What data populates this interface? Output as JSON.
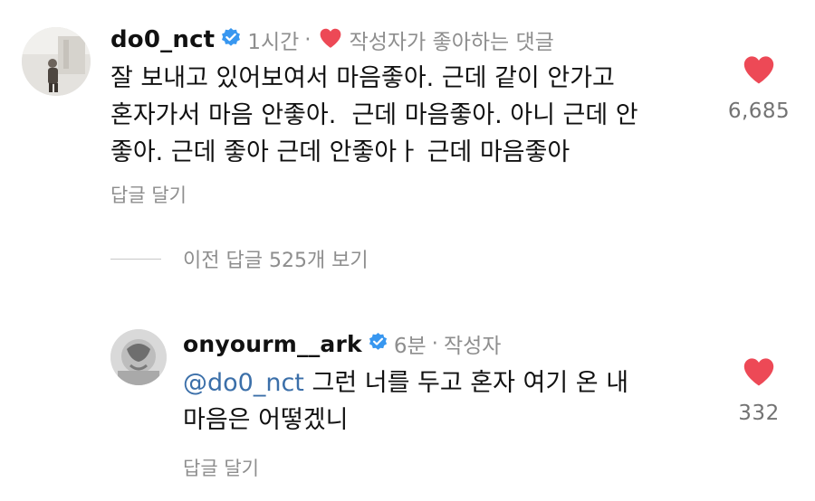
{
  "comment": {
    "username": "do0_nct",
    "time": "1시간",
    "separator": "·",
    "author_liked": "작성자가 좋아하는 댓글",
    "text_lines": [
      "잘 보내고 있어보여서 마음좋아. 근데 같이 안가고",
      "혼자가서 마음 안좋아.  근데 마음좋아. 아니 근데 안",
      "좋아. 근데 좋아 근데 안좋아ㅏ 근데 마음좋아"
    ],
    "reply_label": "답글 달기",
    "like_count": "6,685",
    "heart_color": "#ed4956"
  },
  "view_replies": {
    "label": "이전 답글 525개 보기"
  },
  "reply": {
    "username": "onyourm__ark",
    "time": "6분",
    "separator": "·",
    "author_badge": "작성자",
    "mention": "@do0_nct",
    "text_line1_rest": " 그런 너를 두고 혼자 여기 온 내",
    "text_line2": "마음은 어떻겠니",
    "reply_label": "답글 달기",
    "like_count": "332",
    "heart_color": "#ed4956"
  },
  "colors": {
    "verified": "#3897f0",
    "mention": "#3b6fa9",
    "muted": "#8e8e8e"
  },
  "icons": [
    "verified-badge-icon",
    "heart-icon"
  ]
}
